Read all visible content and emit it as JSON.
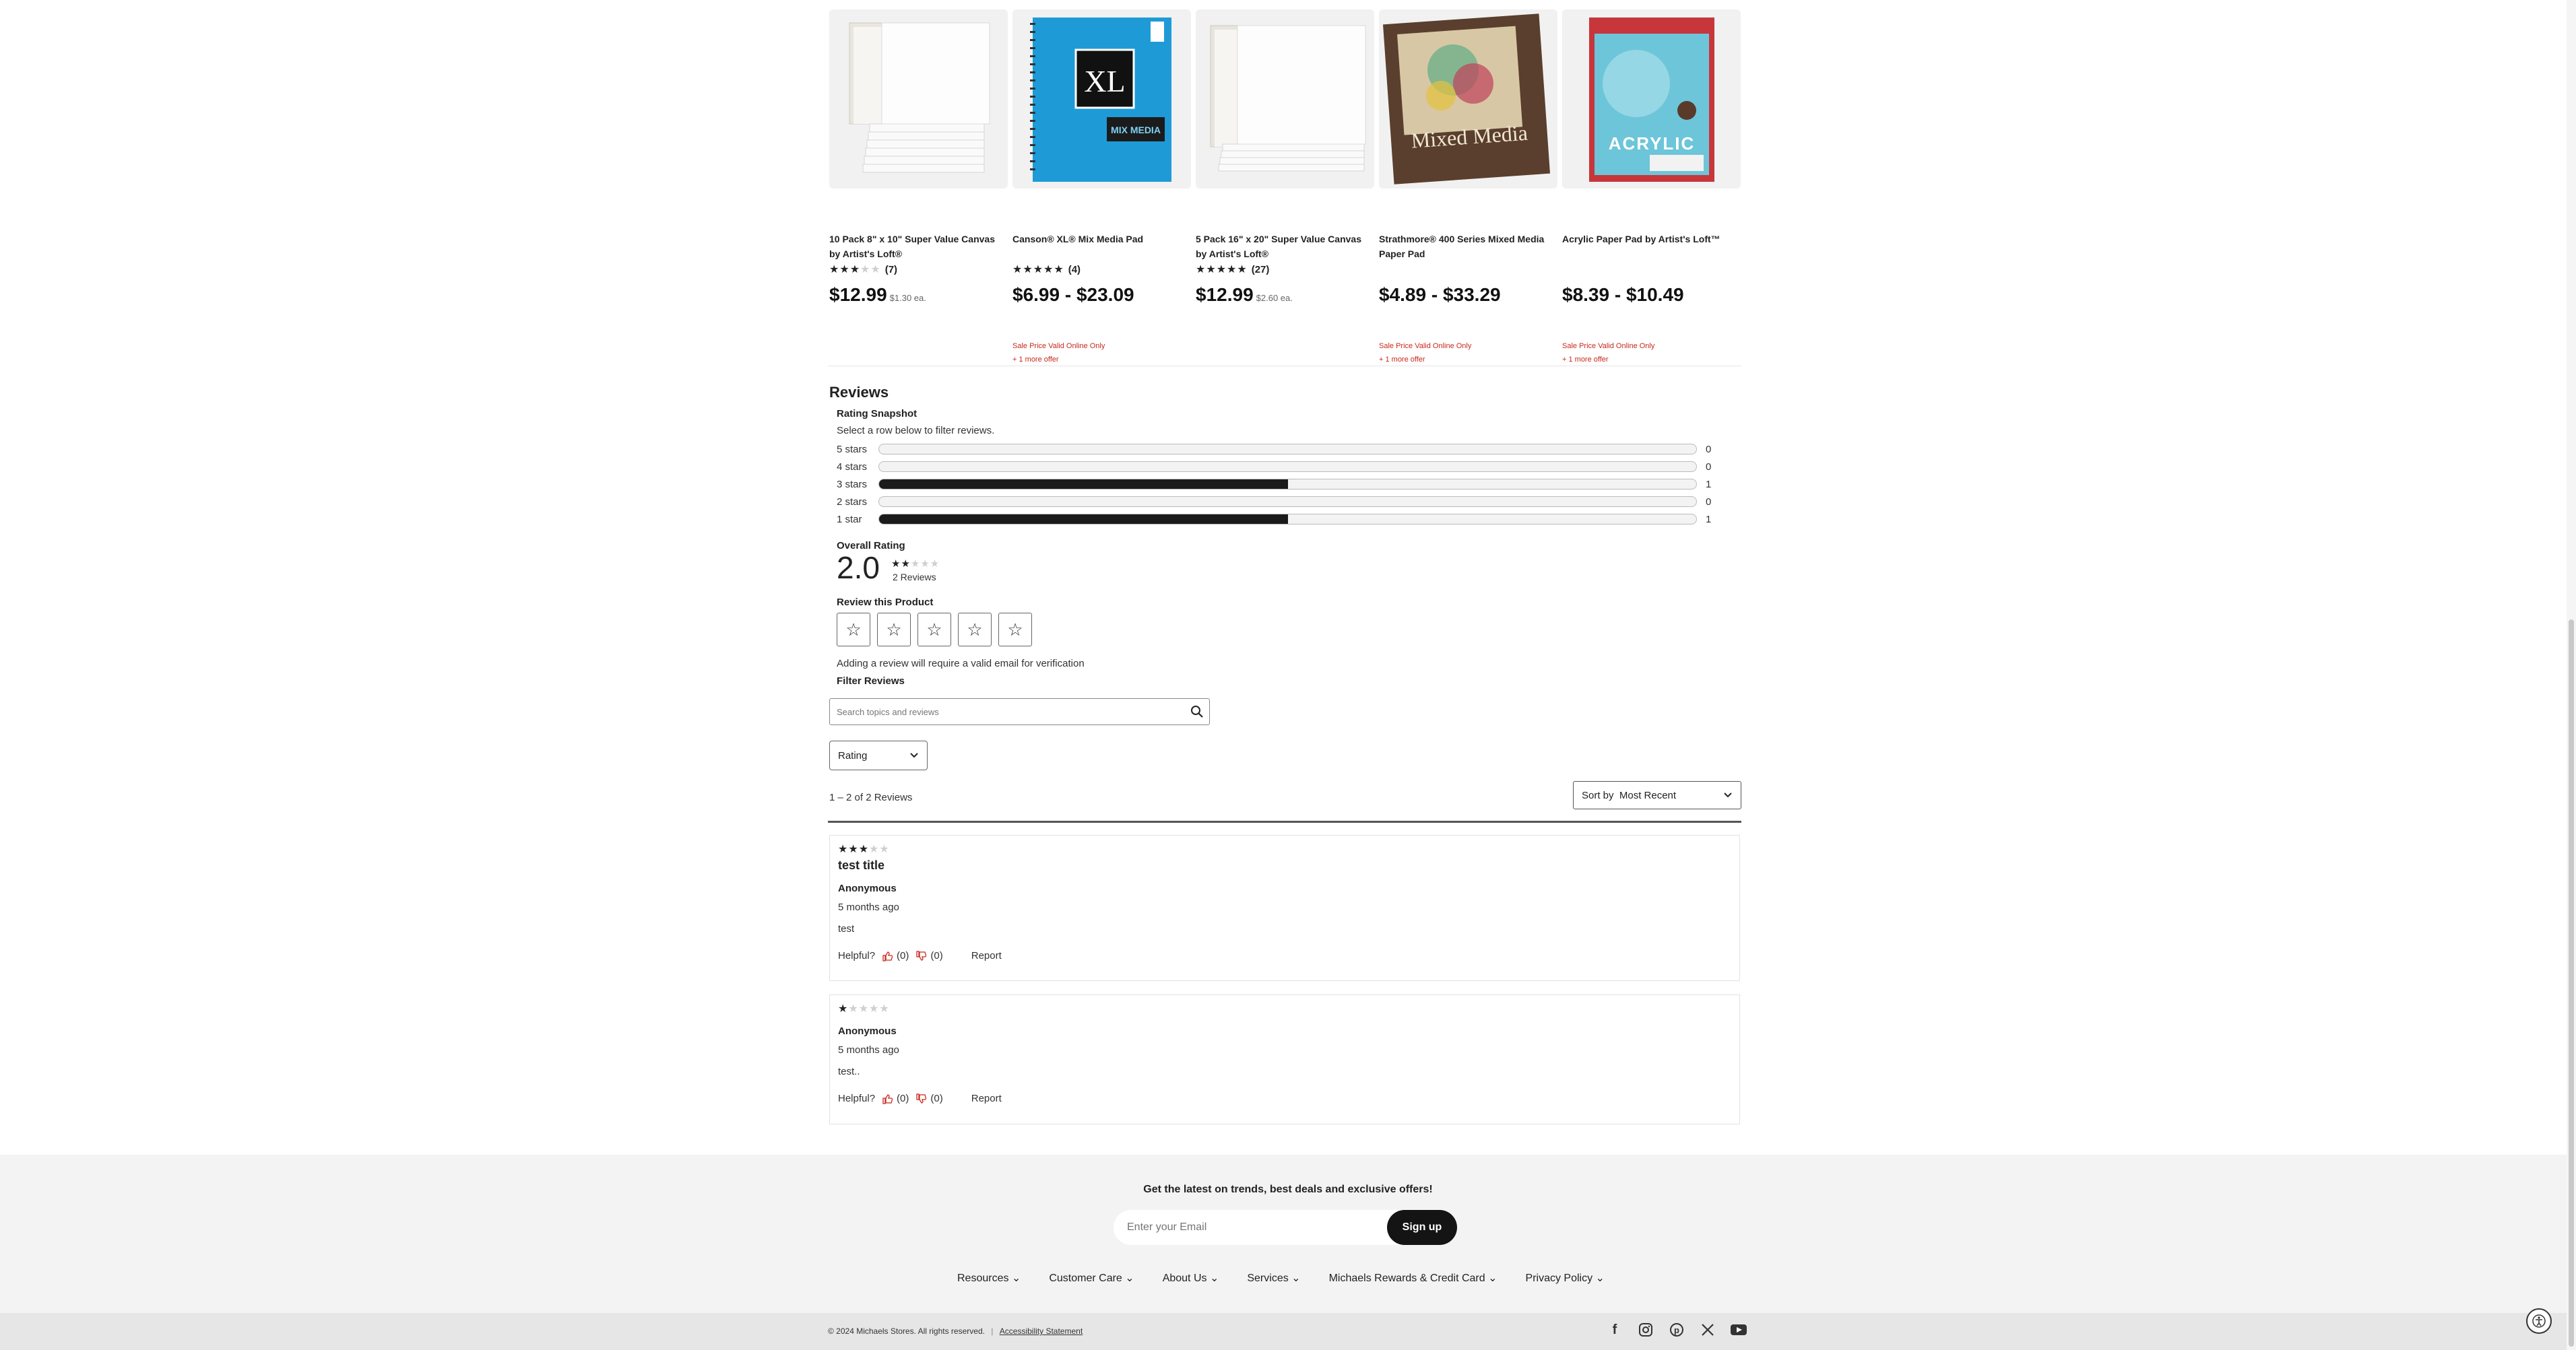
{
  "products": [
    {
      "name": "10 Pack 8\" x 10\" Super Value Canvas by Artist's Loft®",
      "stars": "★★★",
      "stars_off": "★★",
      "count": "(7)",
      "price": "$12.99",
      "each": "$1.30 ea.",
      "sale": "",
      "offer": ""
    },
    {
      "name": "Canson® XL® Mix Media Pad",
      "stars": "★★★★★",
      "stars_off": "",
      "count": "(4)",
      "price": "$6.99 - $23.09",
      "each": "",
      "sale": "Sale Price Valid Online Only",
      "offer": "+ 1 more offer"
    },
    {
      "name": "5 Pack 16\" x 20\" Super Value Canvas by Artist's Loft®",
      "stars": "★★★★★",
      "stars_off": "",
      "count": "(27)",
      "price": "$12.99",
      "each": "$2.60 ea.",
      "sale": "",
      "offer": ""
    },
    {
      "name": "Strathmore® 400 Series Mixed Media Paper Pad",
      "stars": "",
      "stars_off": "",
      "count": "",
      "price": "$4.89 - $33.29",
      "each": "",
      "sale": "Sale Price Valid Online Only",
      "offer": "+ 1 more offer"
    },
    {
      "name": "Acrylic Paper Pad by Artist's Loft™",
      "stars": "",
      "stars_off": "",
      "count": "",
      "price": "$8.39 - $10.49",
      "each": "",
      "sale": "Sale Price Valid Online Only",
      "offer": "+ 1 more offer"
    }
  ],
  "product_art": {
    "canson_brand": "XL",
    "canson_sub": "MIX MEDIA",
    "strathmore_text": "Mixed Media",
    "acrylic_text": "ACRYLIC"
  },
  "reviews": {
    "heading": "Reviews",
    "snapshot_title": "Rating Snapshot",
    "snapshot_sub": "Select a row below to filter reviews.",
    "rows": [
      {
        "label": "5 stars",
        "count": "0",
        "fraction": 0
      },
      {
        "label": "4 stars",
        "count": "0",
        "fraction": 0
      },
      {
        "label": "3 stars",
        "count": "1",
        "fraction": 0.5
      },
      {
        "label": "2 stars",
        "count": "0",
        "fraction": 0
      },
      {
        "label": "1 star",
        "count": "1",
        "fraction": 0.5
      }
    ],
    "overall_title": "Overall Rating",
    "overall_value": "2.0",
    "overall_stars_on": "★★",
    "overall_stars_off": "★★★",
    "overall_count": "2 Reviews",
    "review_product_title": "Review this Product",
    "star_glyph": "☆",
    "review_note": "Adding a review will require a valid email for verification",
    "filter_title": "Filter Reviews",
    "search_placeholder": "Search topics and reviews",
    "rating_select": "Rating",
    "count_line": "1 – 2 of 2 Reviews",
    "sort_label": "Sort by  Most Recent"
  },
  "review_items": [
    {
      "stars_on": "★★★",
      "stars_off": "★★",
      "title": "test title",
      "author": "Anonymous",
      "ago": "5 months ago",
      "body": "test",
      "helpful": "Helpful?",
      "up": "(0)",
      "down": "(0)",
      "report": "Report"
    },
    {
      "stars_on": "★",
      "stars_off": "★★★★",
      "title": "",
      "author": "Anonymous",
      "ago": "5 months ago",
      "body": "test..",
      "helpful": "Helpful?",
      "up": "(0)",
      "down": "(0)",
      "report": "Report"
    }
  ],
  "footer": {
    "newsletter_text": "Get the latest on trends, best deals and exclusive offers!",
    "email_placeholder": "Enter your Email",
    "signup": "Sign up",
    "nav": [
      "Resources",
      "Customer Care",
      "About Us",
      "Services",
      "Michaels Rewards & Credit Card",
      "Privacy Policy"
    ],
    "copyright": "© 2024 Michaels Stores. All rights reserved.",
    "separator": "|",
    "accessibility_link": "Accessibility Statement",
    "socials": [
      "facebook-icon",
      "instagram-icon",
      "pinterest-icon",
      "x-icon",
      "youtube-icon"
    ]
  },
  "colors": {
    "sale_red": "#c8281c",
    "bar_fill": "#1b1b1b",
    "canson_blue": "#1e9bd7"
  }
}
